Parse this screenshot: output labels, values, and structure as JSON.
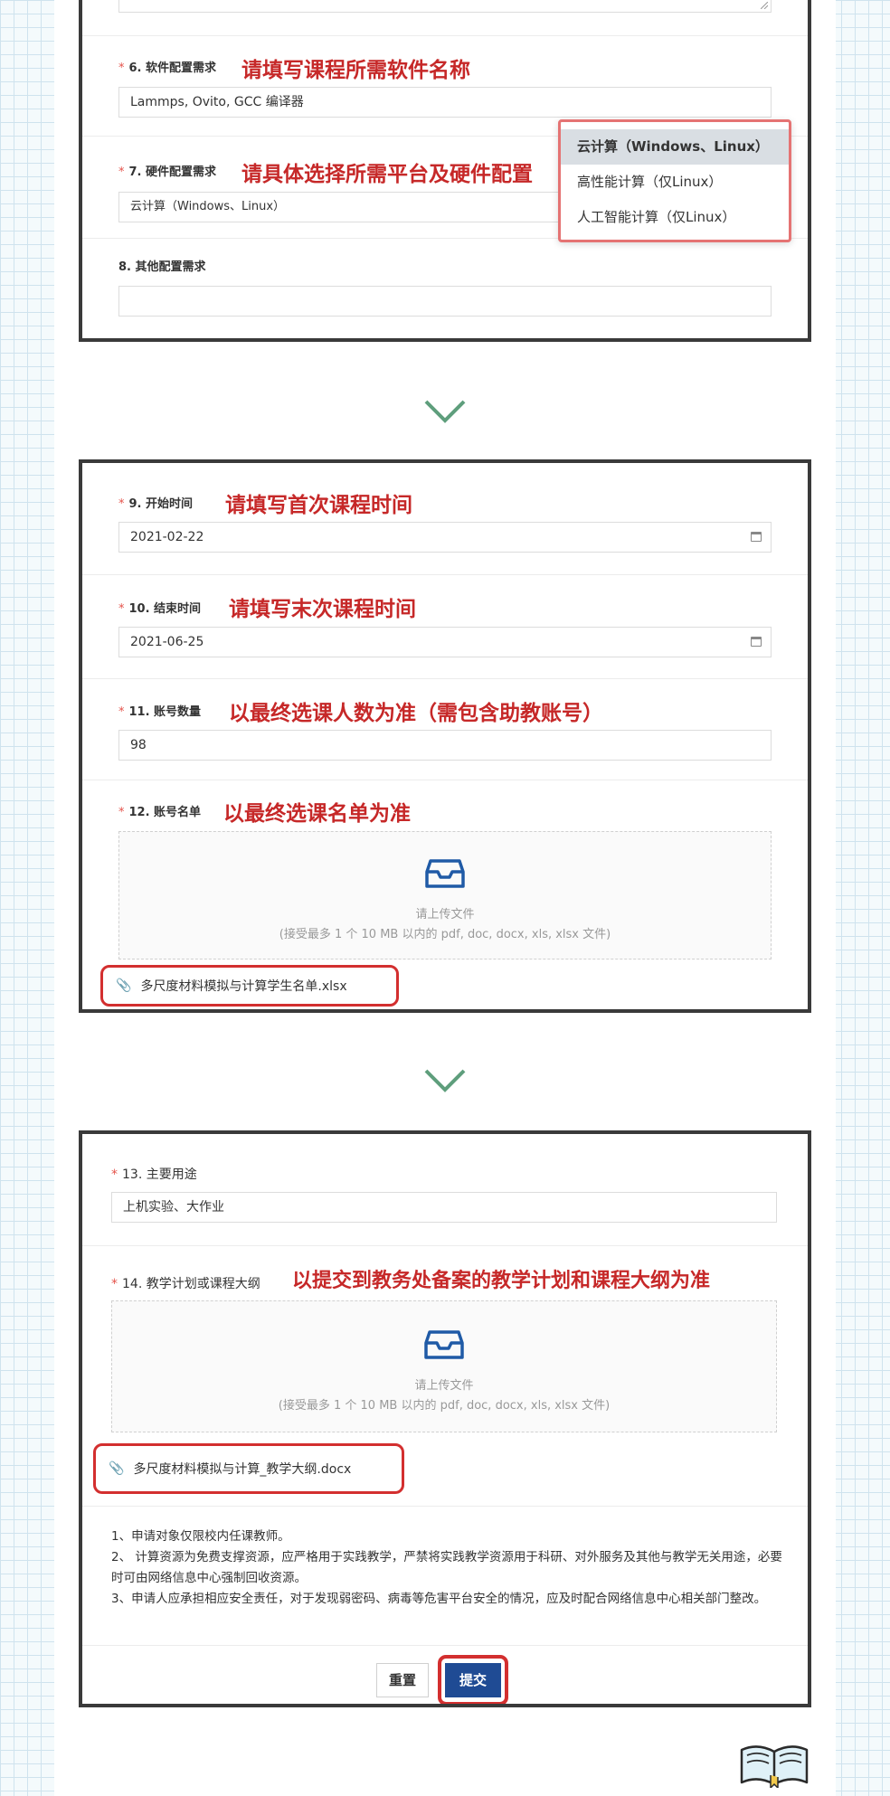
{
  "colors": {
    "accent_red": "#c62828",
    "button_blue": "#1f4b94",
    "required": "#e5534b"
  },
  "section1": {
    "q6": {
      "label": "6. 软件配置需求",
      "annotation": "请填写课程所需软件名称",
      "value": "Lammps, Ovito, GCC 编译器"
    },
    "q7": {
      "label": "7. 硬件配置需求",
      "annotation": "请具体选择所需平台及硬件配置",
      "value": "云计算（Windows、Linux）"
    },
    "q7_options": [
      "云计算（Windows、Linux）",
      "高性能计算（仅Linux）",
      "人工智能计算（仅Linux）"
    ],
    "q8": {
      "label": "8. 其他配置需求",
      "value": ""
    }
  },
  "section2": {
    "q9": {
      "label": "9. 开始时间",
      "annotation": "请填写首次课程时间",
      "value": "2021-02-22"
    },
    "q10": {
      "label": "10. 结束时间",
      "annotation": "请填写末次课程时间",
      "value": "2021-06-25"
    },
    "q11": {
      "label": "11. 账号数量",
      "annotation": "以最终选课人数为准（需包含助教账号）",
      "value": "98"
    },
    "q12": {
      "label": "12. 账号名单",
      "annotation": "以最终选课名单为准"
    },
    "upload_title": "请上传文件",
    "upload_hint": "(接受最多 1 个 10 MB 以内的 pdf, doc, docx, xls, xlsx 文件)",
    "file": "多尺度材料模拟与计算学生名单.xlsx"
  },
  "section3": {
    "q13": {
      "label": "13. 主要用途",
      "value": "上机实验、大作业"
    },
    "q14": {
      "label": "14. 教学计划或课程大纲",
      "annotation": "以提交到教务处备案的教学计划和课程大纲为准"
    },
    "upload_title": "请上传文件",
    "upload_hint": "(接受最多 1 个 10 MB 以内的 pdf, doc, docx, xls, xlsx 文件)",
    "file": "多尺度材料模拟与计算_教学大纲.docx",
    "notes": [
      "1、申请对象仅限校内任课教师。",
      "2、 计算资源为免费支撑资源，应严格用于实践教学，严禁将实践教学资源用于科研、对外服务及其他与教学无关用途，必要时可由网络信息中心强制回收资源。",
      "3、申请人应承担相应安全责任，对于发现弱密码、病毒等危害平台安全的情况，应及时配合网络信息中心相关部门整改。"
    ],
    "reset_label": "重置",
    "submit_label": "提交"
  },
  "icons": {
    "chevron": "chevron-down-icon",
    "upload": "inbox-icon",
    "clip": "paperclip-icon",
    "calendar": "calendar-icon",
    "book": "book-icon"
  }
}
